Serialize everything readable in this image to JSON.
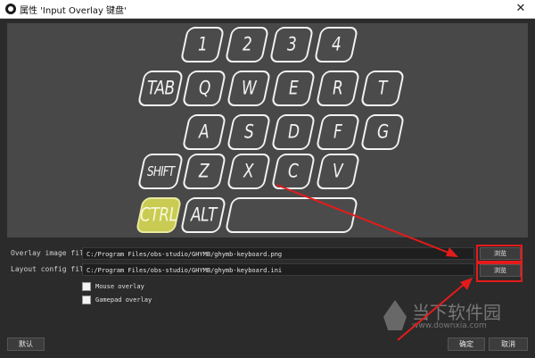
{
  "window": {
    "title": "属性 'Input Overlay 键盘'",
    "close_glyph": "✕"
  },
  "keyboard": {
    "keys": [
      {
        "label": "1",
        "active": false
      },
      {
        "label": "2",
        "active": false
      },
      {
        "label": "3",
        "active": false
      },
      {
        "label": "4",
        "active": false
      },
      {
        "label": "TAB",
        "active": false
      },
      {
        "label": "Q",
        "active": false
      },
      {
        "label": "W",
        "active": false
      },
      {
        "label": "E",
        "active": false
      },
      {
        "label": "R",
        "active": false
      },
      {
        "label": "T",
        "active": false
      },
      {
        "label": "A",
        "active": false
      },
      {
        "label": "S",
        "active": false
      },
      {
        "label": "D",
        "active": false
      },
      {
        "label": "F",
        "active": false
      },
      {
        "label": "G",
        "active": false
      },
      {
        "label": "SHIFT",
        "active": false
      },
      {
        "label": "Z",
        "active": false
      },
      {
        "label": "X",
        "active": false
      },
      {
        "label": "C",
        "active": false
      },
      {
        "label": "V",
        "active": false
      },
      {
        "label": "CTRL",
        "active": true
      },
      {
        "label": "ALT",
        "active": false
      },
      {
        "label": "",
        "active": false
      }
    ],
    "active_color": "#c9cb52"
  },
  "form": {
    "overlay_image_label": "Overlay image file",
    "overlay_image_value": "C:/Program Files/obs-studio/GHYMB/ghymb-keyboard.png",
    "overlay_browse_label": "浏览",
    "layout_config_label": "Layout config file",
    "layout_config_value": "C:/Program Files/obs-studio/GHYMB/ghymb-keyboard.ini",
    "layout_browse_label": "浏览",
    "mouse_overlay_label": "Mouse overlay",
    "mouse_overlay_checked": false,
    "gamepad_overlay_label": "Gamepad overlay",
    "gamepad_overlay_checked": false
  },
  "footer": {
    "defaults_label": "默认",
    "ok_label": "确定",
    "cancel_label": "取消"
  },
  "watermark": {
    "name": "当下软件园",
    "url": "www.downxia.com"
  },
  "annotation_color": "#e41b1b"
}
